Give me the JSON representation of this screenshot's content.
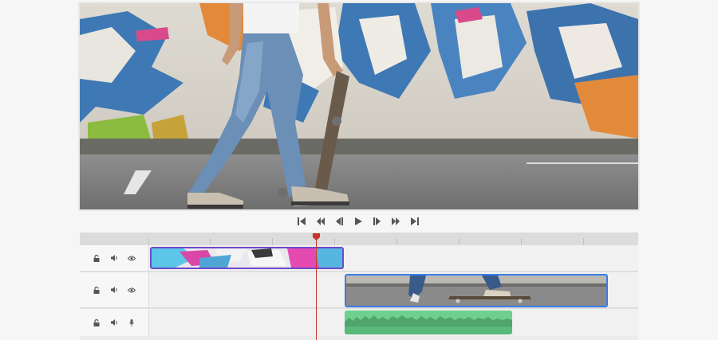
{
  "preview": {
    "scene": "skater-graffiti-wall"
  },
  "transport": {
    "buttons": [
      {
        "name": "skip-to-start-icon"
      },
      {
        "name": "previous-frame-icon"
      },
      {
        "name": "step-back-icon"
      },
      {
        "name": "play-icon"
      },
      {
        "name": "step-forward-icon"
      },
      {
        "name": "next-frame-icon"
      },
      {
        "name": "skip-to-end-icon"
      }
    ]
  },
  "timeline": {
    "tracks": [
      {
        "type": "video",
        "icons": [
          "lock-icon",
          "volume-icon",
          "visibility-eye-icon"
        ]
      },
      {
        "type": "video",
        "icons": [
          "lock-icon",
          "volume-icon",
          "visibility-eye-icon"
        ]
      },
      {
        "type": "audio",
        "icons": [
          "lock-icon",
          "volume-icon",
          "microphone-icon"
        ]
      }
    ],
    "clips": [
      {
        "track": 1,
        "kind": "video",
        "color": "#6c4ac9",
        "thumbnail": "graffiti-colorful"
      },
      {
        "track": 2,
        "kind": "video",
        "color": "#3a7de6",
        "thumbnail": "skateboard-street"
      },
      {
        "track": 3,
        "kind": "audio",
        "color": "#6fcf8f"
      }
    ],
    "playhead_color": "#c8332c"
  },
  "colors": {
    "background": "#f6f6f6",
    "track_bg": "#f1f1f1",
    "ruler_bg": "#dcdcdc",
    "icon": "#555555"
  }
}
